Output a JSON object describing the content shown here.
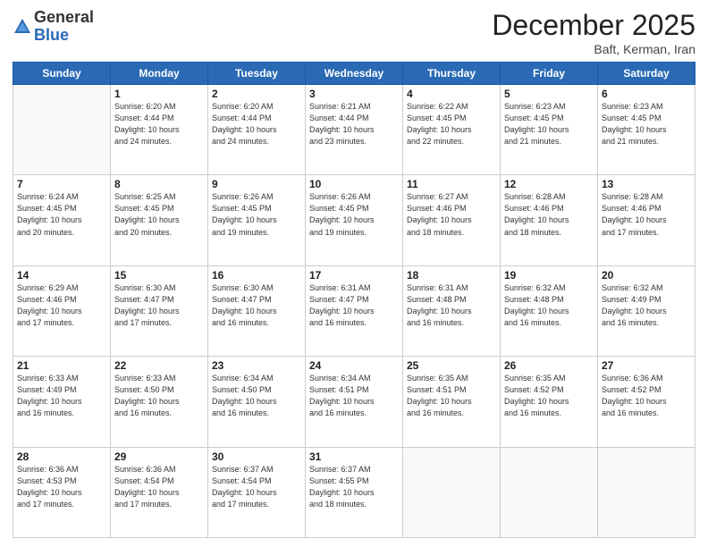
{
  "logo": {
    "general": "General",
    "blue": "Blue"
  },
  "header": {
    "month_year": "December 2025",
    "location": "Baft, Kerman, Iran"
  },
  "weekdays": [
    "Sunday",
    "Monday",
    "Tuesday",
    "Wednesday",
    "Thursday",
    "Friday",
    "Saturday"
  ],
  "weeks": [
    [
      {
        "day": "",
        "info": ""
      },
      {
        "day": "1",
        "info": "Sunrise: 6:20 AM\nSunset: 4:44 PM\nDaylight: 10 hours\nand 24 minutes."
      },
      {
        "day": "2",
        "info": "Sunrise: 6:20 AM\nSunset: 4:44 PM\nDaylight: 10 hours\nand 24 minutes."
      },
      {
        "day": "3",
        "info": "Sunrise: 6:21 AM\nSunset: 4:44 PM\nDaylight: 10 hours\nand 23 minutes."
      },
      {
        "day": "4",
        "info": "Sunrise: 6:22 AM\nSunset: 4:45 PM\nDaylight: 10 hours\nand 22 minutes."
      },
      {
        "day": "5",
        "info": "Sunrise: 6:23 AM\nSunset: 4:45 PM\nDaylight: 10 hours\nand 21 minutes."
      },
      {
        "day": "6",
        "info": "Sunrise: 6:23 AM\nSunset: 4:45 PM\nDaylight: 10 hours\nand 21 minutes."
      }
    ],
    [
      {
        "day": "7",
        "info": "Sunrise: 6:24 AM\nSunset: 4:45 PM\nDaylight: 10 hours\nand 20 minutes."
      },
      {
        "day": "8",
        "info": "Sunrise: 6:25 AM\nSunset: 4:45 PM\nDaylight: 10 hours\nand 20 minutes."
      },
      {
        "day": "9",
        "info": "Sunrise: 6:26 AM\nSunset: 4:45 PM\nDaylight: 10 hours\nand 19 minutes."
      },
      {
        "day": "10",
        "info": "Sunrise: 6:26 AM\nSunset: 4:45 PM\nDaylight: 10 hours\nand 19 minutes."
      },
      {
        "day": "11",
        "info": "Sunrise: 6:27 AM\nSunset: 4:46 PM\nDaylight: 10 hours\nand 18 minutes."
      },
      {
        "day": "12",
        "info": "Sunrise: 6:28 AM\nSunset: 4:46 PM\nDaylight: 10 hours\nand 18 minutes."
      },
      {
        "day": "13",
        "info": "Sunrise: 6:28 AM\nSunset: 4:46 PM\nDaylight: 10 hours\nand 17 minutes."
      }
    ],
    [
      {
        "day": "14",
        "info": "Sunrise: 6:29 AM\nSunset: 4:46 PM\nDaylight: 10 hours\nand 17 minutes."
      },
      {
        "day": "15",
        "info": "Sunrise: 6:30 AM\nSunset: 4:47 PM\nDaylight: 10 hours\nand 17 minutes."
      },
      {
        "day": "16",
        "info": "Sunrise: 6:30 AM\nSunset: 4:47 PM\nDaylight: 10 hours\nand 16 minutes."
      },
      {
        "day": "17",
        "info": "Sunrise: 6:31 AM\nSunset: 4:47 PM\nDaylight: 10 hours\nand 16 minutes."
      },
      {
        "day": "18",
        "info": "Sunrise: 6:31 AM\nSunset: 4:48 PM\nDaylight: 10 hours\nand 16 minutes."
      },
      {
        "day": "19",
        "info": "Sunrise: 6:32 AM\nSunset: 4:48 PM\nDaylight: 10 hours\nand 16 minutes."
      },
      {
        "day": "20",
        "info": "Sunrise: 6:32 AM\nSunset: 4:49 PM\nDaylight: 10 hours\nand 16 minutes."
      }
    ],
    [
      {
        "day": "21",
        "info": "Sunrise: 6:33 AM\nSunset: 4:49 PM\nDaylight: 10 hours\nand 16 minutes."
      },
      {
        "day": "22",
        "info": "Sunrise: 6:33 AM\nSunset: 4:50 PM\nDaylight: 10 hours\nand 16 minutes."
      },
      {
        "day": "23",
        "info": "Sunrise: 6:34 AM\nSunset: 4:50 PM\nDaylight: 10 hours\nand 16 minutes."
      },
      {
        "day": "24",
        "info": "Sunrise: 6:34 AM\nSunset: 4:51 PM\nDaylight: 10 hours\nand 16 minutes."
      },
      {
        "day": "25",
        "info": "Sunrise: 6:35 AM\nSunset: 4:51 PM\nDaylight: 10 hours\nand 16 minutes."
      },
      {
        "day": "26",
        "info": "Sunrise: 6:35 AM\nSunset: 4:52 PM\nDaylight: 10 hours\nand 16 minutes."
      },
      {
        "day": "27",
        "info": "Sunrise: 6:36 AM\nSunset: 4:52 PM\nDaylight: 10 hours\nand 16 minutes."
      }
    ],
    [
      {
        "day": "28",
        "info": "Sunrise: 6:36 AM\nSunset: 4:53 PM\nDaylight: 10 hours\nand 17 minutes."
      },
      {
        "day": "29",
        "info": "Sunrise: 6:36 AM\nSunset: 4:54 PM\nDaylight: 10 hours\nand 17 minutes."
      },
      {
        "day": "30",
        "info": "Sunrise: 6:37 AM\nSunset: 4:54 PM\nDaylight: 10 hours\nand 17 minutes."
      },
      {
        "day": "31",
        "info": "Sunrise: 6:37 AM\nSunset: 4:55 PM\nDaylight: 10 hours\nand 18 minutes."
      },
      {
        "day": "",
        "info": ""
      },
      {
        "day": "",
        "info": ""
      },
      {
        "day": "",
        "info": ""
      }
    ]
  ]
}
